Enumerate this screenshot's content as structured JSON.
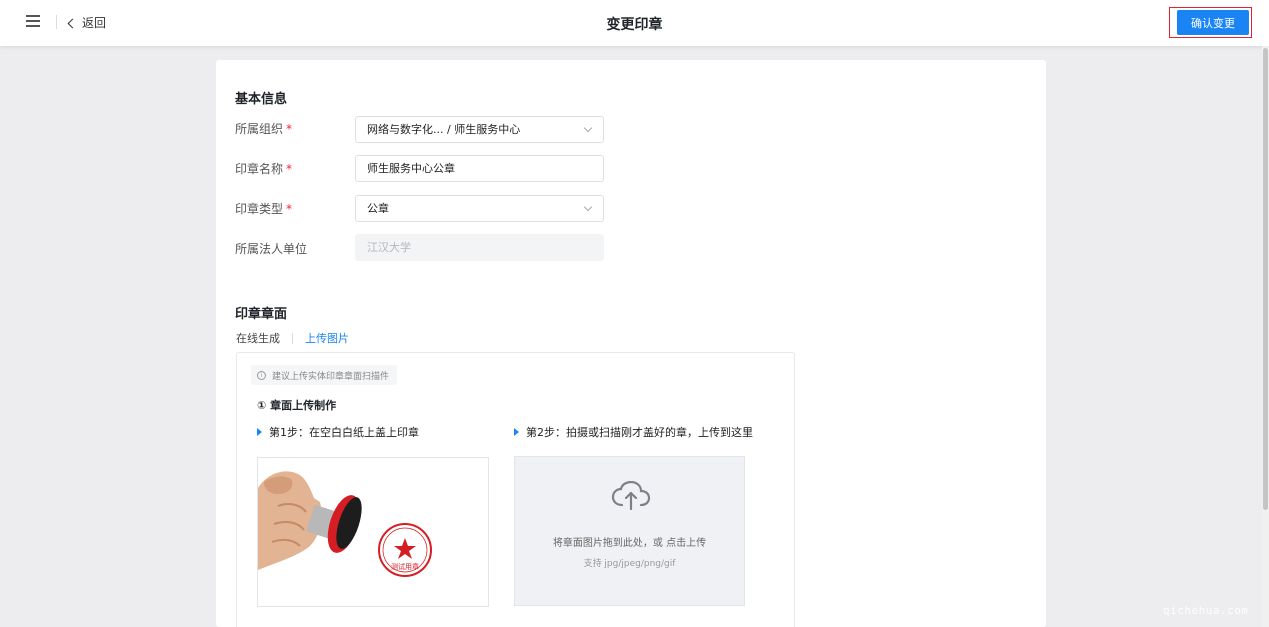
{
  "header": {
    "back_label": "返回",
    "title": "变更印章",
    "confirm_label": "确认变更"
  },
  "basic_info": {
    "title": "基本信息",
    "fields": [
      {
        "label": "所属组织",
        "required": true,
        "value": "网络与数字化... / 师生服务中心",
        "type": "select"
      },
      {
        "label": "印章名称",
        "required": true,
        "value": "师生服务中心公章",
        "type": "input"
      },
      {
        "label": "印章类型",
        "required": true,
        "value": "公章",
        "type": "select"
      },
      {
        "label": "所属法人单位",
        "required": false,
        "value": "江汉大学",
        "type": "disabled"
      }
    ]
  },
  "seal_face": {
    "title": "印章章面",
    "tabs": [
      {
        "label": "在线生成"
      },
      {
        "label": "上传图片"
      }
    ],
    "tip": "建议上传实体印章章面扫描件",
    "subheading": "① 章面上传制作",
    "step1": "第1步：在空白白纸上盖上印章",
    "step2": "第2步：拍摄或扫描刚才盖好的章，上传到这里",
    "example_stamp_text": "测试用章",
    "upload": {
      "main": "将章面图片拖到此处，或 点击上传",
      "sub": "支持 jpg/jpeg/png/gif"
    }
  },
  "watermark": "qichehua.com",
  "colors": {
    "accent": "#1a84f5",
    "required": "#f5222d",
    "highlight_box": "#e0232e"
  }
}
